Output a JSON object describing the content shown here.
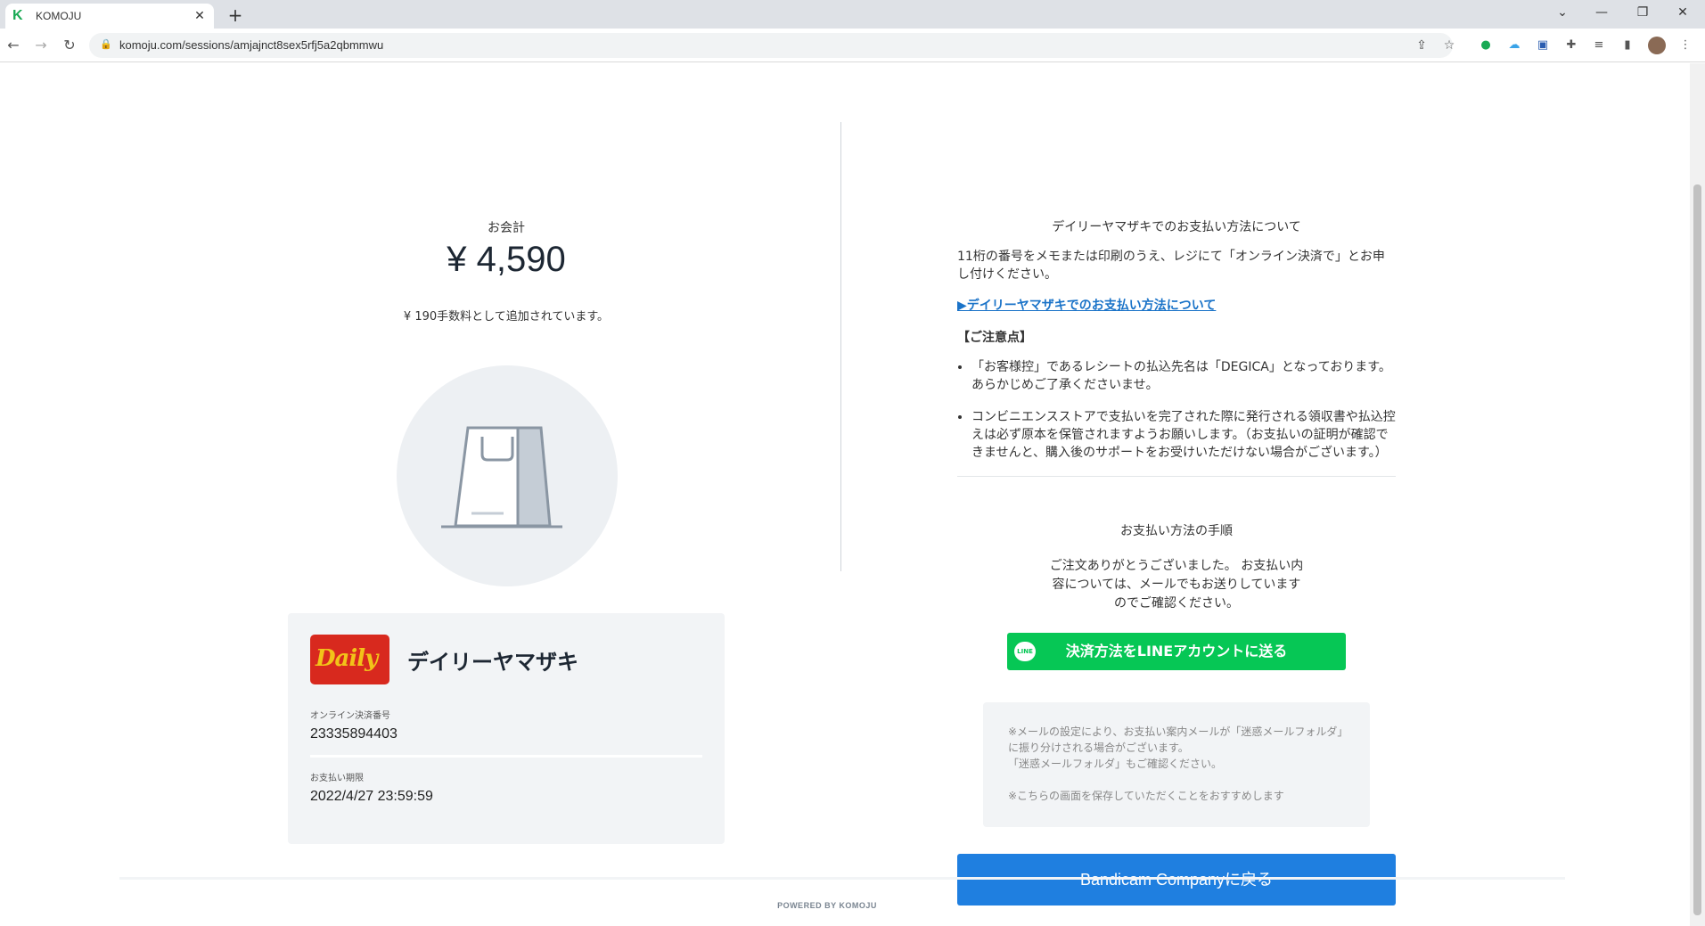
{
  "browser": {
    "tab_title": "KOMOJU",
    "tab_favicon": "K",
    "url": "komoju.com/sessions/amjajnct8sex5rfj5a2qbmmwu"
  },
  "summary": {
    "total_label": "お会計",
    "total_amount": "¥ 4,590",
    "fee_note": "¥ 190手数料として追加されています。"
  },
  "store": {
    "logo_text": "Daily",
    "name": "デイリーヤマザキ",
    "payment_number_label": "オンライン決済番号",
    "payment_number": "23335894403",
    "deadline_label": "お支払い期限",
    "deadline": "2022/4/27 23:59:59"
  },
  "instructions": {
    "title": "デイリーヤマザキでのお支払い方法について",
    "description": "11桁の番号をメモまたは印刷のうえ、レジにて「オンライン決済で」とお申し付けください。",
    "link": "▶デイリーヤマザキでのお支払い方法について",
    "caution_heading": "【ご注意点】",
    "cautions": [
      "「お客様控」であるレシートの払込先名は「DEGICA」となっております。あらかじめご了承くださいませ。",
      "コンビニエンスストアで支払いを完了された際に発行される領収書や払込控えは必ず原本を保管されますようお願いします。（お支払いの証明が確認できませんと、購入後のサポートをお受けいただけない場合がございます。）"
    ]
  },
  "steps": {
    "title": "お支払い方法の手順",
    "thanks": "ご注文ありがとうございました。 お支払い内容については、メールでもお送りしていますのでご確認ください。",
    "line_button": "決済方法をLINEアカウントに送る",
    "line_icon": "LINE",
    "notice_1": "※メールの設定により、お支払い案内メールが「迷惑メールフォルダ」に振り分けされる場合がございます。",
    "notice_2": "「迷惑メールフォルダ」もご確認ください。",
    "notice_3": "※こちらの画面を保存していただくことをおすすめします"
  },
  "back_button": "Bandicam Companyに戻る",
  "footer": "POWERED BY KOMOJU",
  "colors": {
    "line_green": "#06c755",
    "primary_blue": "#1f7fe0",
    "link_blue": "#1a73c8"
  }
}
